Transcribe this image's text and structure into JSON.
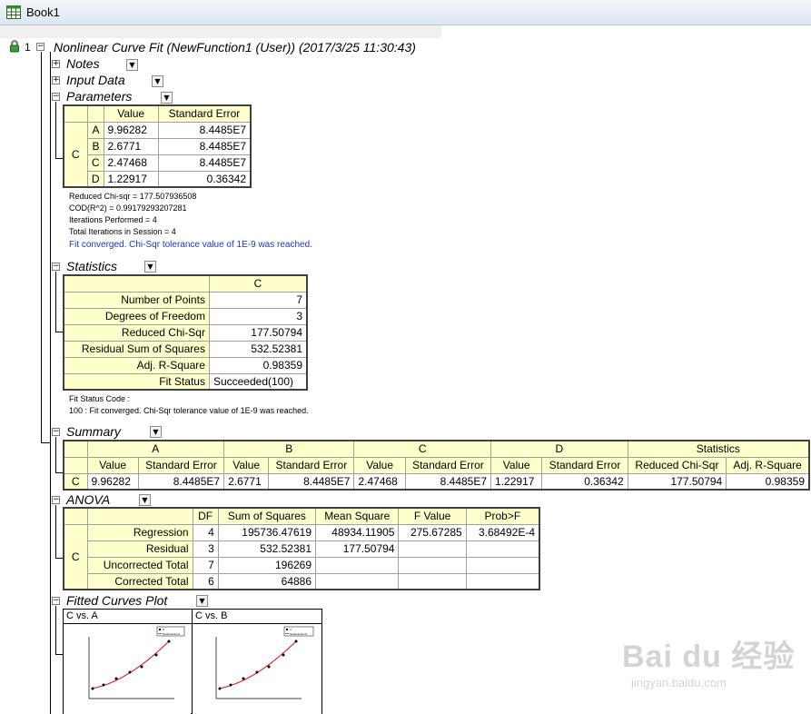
{
  "window": {
    "title": "Book1"
  },
  "report": {
    "index": "1",
    "title": "Nonlinear Curve Fit (NewFunction1 (User)) (2017/3/25 11:30:43)"
  },
  "sections": {
    "notes": "Notes",
    "input_data": "Input Data",
    "parameters": "Parameters",
    "statistics": "Statistics",
    "summary": "Summary",
    "anova": "ANOVA",
    "fitted_curves": "Fitted Curves Plot"
  },
  "parameters": {
    "headers": [
      "Value",
      "Standard Error"
    ],
    "group": "C",
    "rows": [
      {
        "name": "A",
        "value": "9.96282",
        "se": "8.4485E7"
      },
      {
        "name": "B",
        "value": "2.6771",
        "se": "8.4485E7"
      },
      {
        "name": "C",
        "value": "2.47468",
        "se": "8.4485E7"
      },
      {
        "name": "D",
        "value": "1.22917",
        "se": "0.36342"
      }
    ],
    "notes": [
      "Reduced Chi-sqr = 177.507936508",
      "COD(R^2) = 0.99179293207281",
      "Iterations Performed = 4",
      "Total Iterations in Session = 4"
    ],
    "converged": "Fit converged. Chi-Sqr tolerance value of 1E-9 was reached."
  },
  "statistics": {
    "column": "C",
    "rows": [
      {
        "label": "Number of Points",
        "value": "7"
      },
      {
        "label": "Degrees of Freedom",
        "value": "3"
      },
      {
        "label": "Reduced Chi-Sqr",
        "value": "177.50794"
      },
      {
        "label": "Residual Sum of Squares",
        "value": "532.52381"
      },
      {
        "label": "Adj. R-Square",
        "value": "0.98359"
      },
      {
        "label": "Fit Status",
        "value": "Succeeded(100)"
      }
    ],
    "notes": [
      "Fit Status Code :",
      "100 : Fit converged. Chi-Sqr tolerance value of 1E-9 was reached."
    ]
  },
  "summary": {
    "groups": [
      "A",
      "B",
      "C",
      "D",
      "Statistics"
    ],
    "subheaders": [
      "Value",
      "Standard Error",
      "Value",
      "Standard Error",
      "Value",
      "Standard Error",
      "Value",
      "Standard Error",
      "Reduced Chi-Sqr",
      "Adj. R-Square"
    ],
    "row_label": "C",
    "values": [
      "9.96282",
      "8.4485E7",
      "2.6771",
      "8.4485E7",
      "2.47468",
      "8.4485E7",
      "1.22917",
      "0.36342",
      "177.50794",
      "0.98359"
    ]
  },
  "anova": {
    "headers": [
      "DF",
      "Sum of Squares",
      "Mean Square",
      "F Value",
      "Prob>F"
    ],
    "group": "C",
    "rows": [
      {
        "label": "Regression",
        "df": "4",
        "ss": "195736.47619",
        "ms": "48934.11905",
        "f": "275.67285",
        "p": "3.68492E-4"
      },
      {
        "label": "Residual",
        "df": "3",
        "ss": "532.52381",
        "ms": "177.50794",
        "f": "",
        "p": ""
      },
      {
        "label": "Uncorrected Total",
        "df": "7",
        "ss": "196269",
        "ms": "",
        "f": "",
        "p": ""
      },
      {
        "label": "Corrected Total",
        "df": "6",
        "ss": "64886",
        "ms": "",
        "f": "",
        "p": ""
      }
    ]
  },
  "plots": [
    {
      "title": "C vs. A",
      "legend": [
        "C",
        "NewFunction1"
      ]
    },
    {
      "title": "C vs. B",
      "legend": [
        "C",
        "NewFunction1"
      ]
    }
  ],
  "colors": {
    "table_header": "#ffffcc",
    "converged_text": "#1f33c8",
    "fit_curve": "#e01010"
  },
  "watermark": {
    "brand": "Bai du 经验",
    "url": "jingyan.baidu.com"
  }
}
